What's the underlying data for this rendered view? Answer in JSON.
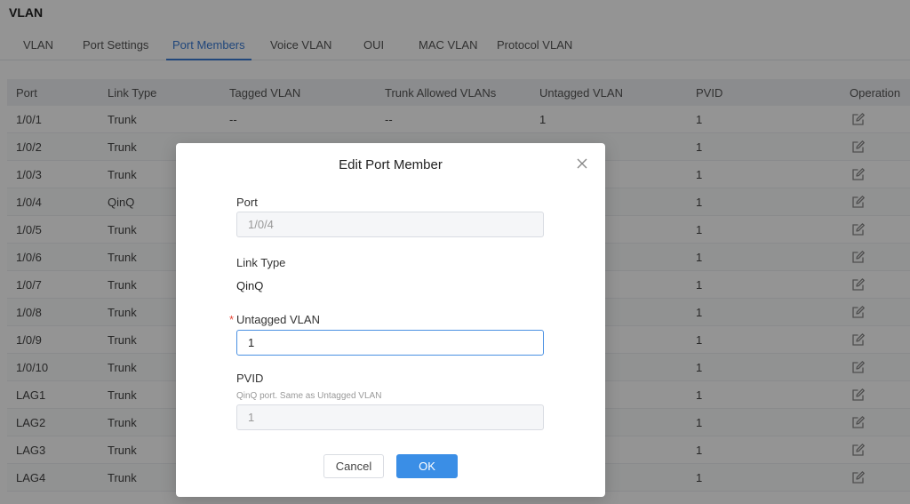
{
  "page": {
    "title": "VLAN"
  },
  "tabs": [
    {
      "label": "VLAN"
    },
    {
      "label": "Port Settings"
    },
    {
      "label": "Port Members"
    },
    {
      "label": "Voice VLAN"
    },
    {
      "label": "OUI"
    },
    {
      "label": "MAC VLAN"
    },
    {
      "label": "Protocol VLAN"
    }
  ],
  "table": {
    "headers": [
      "Port",
      "Link Type",
      "Tagged VLAN",
      "Trunk Allowed VLANs",
      "Untagged VLAN",
      "PVID",
      "Operation"
    ],
    "rows": [
      {
        "port": "1/0/1",
        "link": "Trunk",
        "tagged": "--",
        "trunk": "--",
        "untagged": "1",
        "pvid": "1"
      },
      {
        "port": "1/0/2",
        "link": "Trunk",
        "tagged": "",
        "trunk": "",
        "untagged": "",
        "pvid": "1"
      },
      {
        "port": "1/0/3",
        "link": "Trunk",
        "tagged": "",
        "trunk": "",
        "untagged": "",
        "pvid": "1"
      },
      {
        "port": "1/0/4",
        "link": "QinQ",
        "tagged": "",
        "trunk": "",
        "untagged": "",
        "pvid": "1"
      },
      {
        "port": "1/0/5",
        "link": "Trunk",
        "tagged": "",
        "trunk": "",
        "untagged": "",
        "pvid": "1"
      },
      {
        "port": "1/0/6",
        "link": "Trunk",
        "tagged": "",
        "trunk": "",
        "untagged": "",
        "pvid": "1"
      },
      {
        "port": "1/0/7",
        "link": "Trunk",
        "tagged": "",
        "trunk": "",
        "untagged": "",
        "pvid": "1"
      },
      {
        "port": "1/0/8",
        "link": "Trunk",
        "tagged": "",
        "trunk": "",
        "untagged": "",
        "pvid": "1"
      },
      {
        "port": "1/0/9",
        "link": "Trunk",
        "tagged": "",
        "trunk": "",
        "untagged": "",
        "pvid": "1"
      },
      {
        "port": "1/0/10",
        "link": "Trunk",
        "tagged": "",
        "trunk": "",
        "untagged": "",
        "pvid": "1"
      },
      {
        "port": "LAG1",
        "link": "Trunk",
        "tagged": "",
        "trunk": "",
        "untagged": "",
        "pvid": "1"
      },
      {
        "port": "LAG2",
        "link": "Trunk",
        "tagged": "",
        "trunk": "",
        "untagged": "",
        "pvid": "1"
      },
      {
        "port": "LAG3",
        "link": "Trunk",
        "tagged": "",
        "trunk": "",
        "untagged": "",
        "pvid": "1"
      },
      {
        "port": "LAG4",
        "link": "Trunk",
        "tagged": "",
        "trunk": "",
        "untagged": "",
        "pvid": "1"
      }
    ],
    "operation_icon": "edit-icon"
  },
  "dialog": {
    "title": "Edit Port Member",
    "port_label": "Port",
    "port_value": "1/0/4",
    "link_type_label": "Link Type",
    "link_type_value": "QinQ",
    "untagged_label": "Untagged VLAN",
    "required_mark": "*",
    "untagged_value": "1",
    "pvid_label": "PVID",
    "pvid_hint": "QinQ port. Same as Untagged VLAN",
    "pvid_value": "1",
    "cancel_label": "Cancel",
    "ok_label": "OK"
  },
  "colors": {
    "accent": "#3a8ee6",
    "tab_active": "#3a7bd5",
    "required": "#e74c3c"
  }
}
